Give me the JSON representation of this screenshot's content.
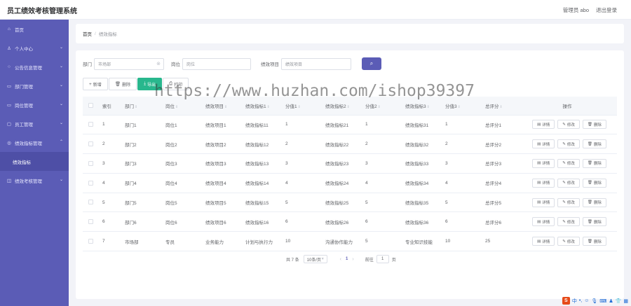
{
  "header": {
    "title": "员工绩效考核管理系统",
    "user": "管理员 abo",
    "logout": "退出登录"
  },
  "sidebar": {
    "items": [
      {
        "label": "首页",
        "icon": "home-icon",
        "glyph": "⌂",
        "chevron": false
      },
      {
        "label": "个人中心",
        "icon": "user-icon",
        "glyph": "♙",
        "chevron": true
      },
      {
        "label": "公告信息管理",
        "icon": "bulb-icon",
        "glyph": "○",
        "chevron": true
      },
      {
        "label": "部门管理",
        "icon": "folder-icon",
        "glyph": "▭",
        "chevron": true
      },
      {
        "label": "岗位管理",
        "icon": "post-icon",
        "glyph": "▭",
        "chevron": true
      },
      {
        "label": "员工管理",
        "icon": "staff-icon",
        "glyph": "▢",
        "chevron": true
      },
      {
        "label": "绩效指标管理",
        "icon": "target-icon",
        "glyph": "◎",
        "chevron": true,
        "expanded": true
      },
      {
        "label": "绩效指标",
        "sub": true
      },
      {
        "label": "绩效考核管理",
        "icon": "chart-icon",
        "glyph": "◫",
        "chevron": true
      }
    ]
  },
  "breadcrumb": {
    "home": "首页",
    "sep": "/",
    "current": "绩效指标"
  },
  "filter": {
    "dept_label": "部门",
    "dept_value": "市场部",
    "post_label": "岗位",
    "post_placeholder": "岗位",
    "item_label": "绩效项目",
    "item_placeholder": "绩效项目"
  },
  "toolbar": {
    "add": "新增",
    "delete": "删除",
    "export": "导出",
    "print": "打印"
  },
  "table": {
    "columns": [
      "索引",
      "部门",
      "岗位",
      "绩效项目",
      "绩效指标1",
      "分值1",
      "绩效指标2",
      "分值2",
      "绩效指标3",
      "分值3",
      "总评分",
      "操作"
    ],
    "rows": [
      [
        "1",
        "部门1",
        "岗位1",
        "绩效项目1",
        "绩效指标11",
        "1",
        "绩效指标21",
        "1",
        "绩效指标31",
        "1",
        "总评分1"
      ],
      [
        "2",
        "部门2",
        "岗位2",
        "绩效项目2",
        "绩效指标12",
        "2",
        "绩效指标22",
        "2",
        "绩效指标32",
        "2",
        "总评分2"
      ],
      [
        "3",
        "部门3",
        "岗位3",
        "绩效项目3",
        "绩效指标13",
        "3",
        "绩效指标23",
        "3",
        "绩效指标33",
        "3",
        "总评分3"
      ],
      [
        "4",
        "部门4",
        "岗位4",
        "绩效项目4",
        "绩效指标14",
        "4",
        "绩效指标24",
        "4",
        "绩效指标34",
        "4",
        "总评分4"
      ],
      [
        "5",
        "部门5",
        "岗位5",
        "绩效项目5",
        "绩效指标15",
        "5",
        "绩效指标25",
        "5",
        "绩效指标35",
        "5",
        "总评分5"
      ],
      [
        "6",
        "部门6",
        "岗位6",
        "绩效项目6",
        "绩效指标16",
        "6",
        "绩效指标26",
        "6",
        "绩效指标36",
        "6",
        "总评分6"
      ],
      [
        "7",
        "市场部",
        "专员",
        "业务能力",
        "计划与执行力",
        "10",
        "沟通协作能力",
        "5",
        "专业知识技能",
        "10",
        "25"
      ]
    ],
    "ops": {
      "detail": "详情",
      "edit": "修改",
      "delete": "删除"
    }
  },
  "pager": {
    "total": "共 7 条",
    "page_size": "10条/页",
    "current": "1",
    "goto": "前往",
    "goto_value": "1",
    "page_unit": "页"
  },
  "watermark": "https://www.huzhan.com/ishop39397",
  "colors": {
    "primary": "#5b5cb6",
    "export": "#28b78d"
  }
}
